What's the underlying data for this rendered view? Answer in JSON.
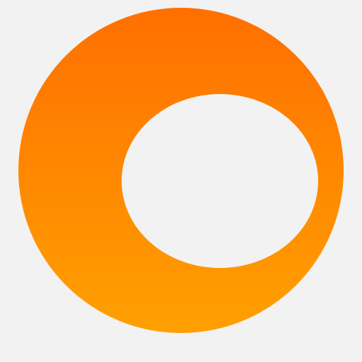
{
  "logo": {
    "icon": "orange-ring-logo",
    "colors": {
      "background": "#f2f2f2",
      "gradient_top": "#ff6f00",
      "gradient_bottom": "#ffa000",
      "inner_hole": "#f2f2f2"
    }
  }
}
